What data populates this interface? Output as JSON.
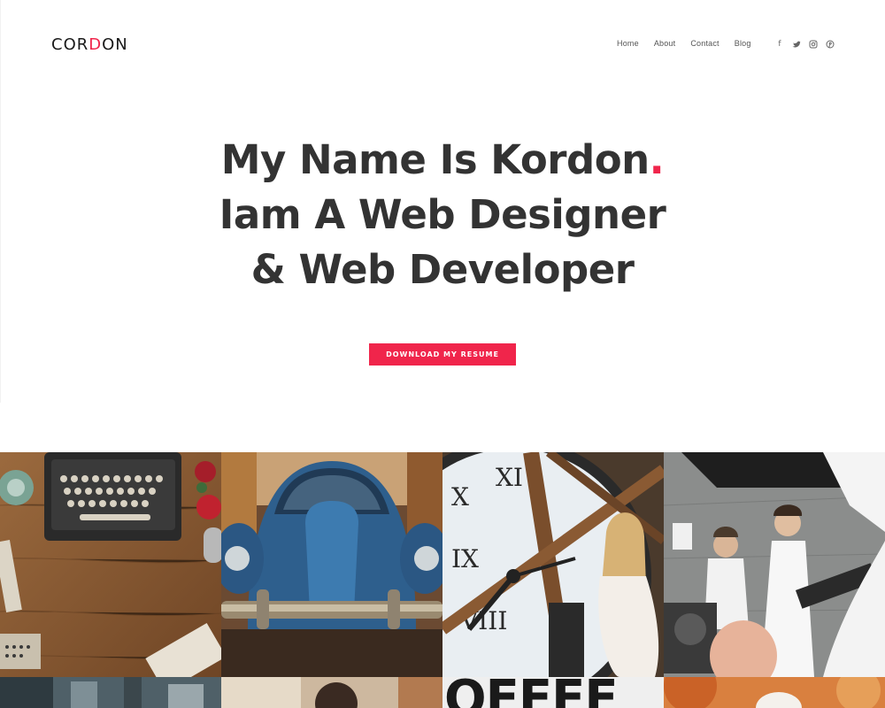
{
  "brand": {
    "logo_pre": "COR",
    "logo_accent": "D",
    "logo_post": "ON",
    "accent_color": "#f0254b",
    "text_color": "#333333"
  },
  "nav": {
    "items": [
      {
        "label": "Home"
      },
      {
        "label": "About"
      },
      {
        "label": "Contact"
      },
      {
        "label": "Blog"
      }
    ]
  },
  "social": {
    "icons": [
      "facebook-icon",
      "twitter-icon",
      "instagram-icon",
      "pinterest-icon"
    ],
    "glyphs": [
      "f",
      "t",
      "◎",
      "℗"
    ]
  },
  "hero": {
    "line1": "My Name Is Kordon",
    "line1_dot": ".",
    "line2": "Iam A Web Designer",
    "line3": "& Web Developer",
    "cta_label": "DOWNLOAD MY RESUME"
  },
  "gallery": {
    "bottom_text": "OFFEE"
  }
}
